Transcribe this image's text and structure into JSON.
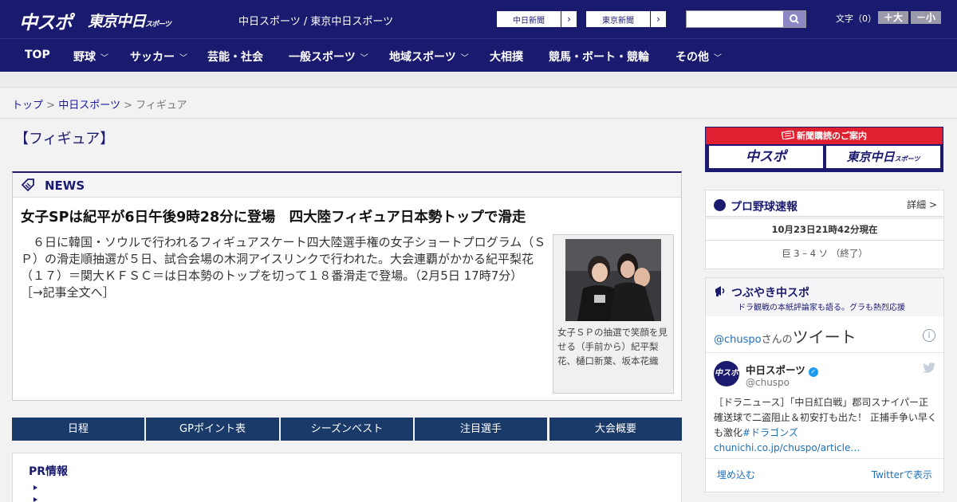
{
  "header": {
    "logo_main": "中スポ",
    "logo_tokyo": "東京中日",
    "logo_tokyo_small": "スポーツ",
    "site_name": "中日スポーツ / 東京中日スポーツ",
    "links": [
      "中日新聞",
      "東京新聞"
    ],
    "font_size_label": "文字（0）",
    "font_larger": "＋大",
    "font_smaller": "－小"
  },
  "nav": {
    "items": [
      {
        "label": "TOP"
      },
      {
        "label": "野球"
      },
      {
        "label": "サッカー"
      },
      {
        "label": "芸能・社会"
      },
      {
        "label": "一般スポーツ"
      },
      {
        "label": "地域スポーツ"
      },
      {
        "label": "大相撲"
      },
      {
        "label": "競馬・ボート・競輪"
      },
      {
        "label": "その他"
      }
    ],
    "chevron": "﹀"
  },
  "breadcrumb": {
    "items": [
      "トップ",
      "中日スポーツ",
      "フィギュア"
    ],
    "separator": ">"
  },
  "page_title": "【フィギュア】",
  "news": {
    "section_label": "NEWS",
    "headline": "女子SPは紀平が6日午後9時28分に登場　四大陸フィギュア日本勢トップで滑走",
    "body": "　６日に韓国・ソウルで行われるフィギュアスケート四大陸選手権の女子ショートプログラム（ＳＰ）の滑走順抽選が５日、試合会場の木洞アイスリンクで行われた。大会連覇がかかる紀平梨花（１７）＝関大ＫＦＳＣ＝は日本勢のトップを切って１８番滑走で登場。（2月5日 17時7分）",
    "more_link": "［→記事全文へ］",
    "photo_caption": "女子ＳＰの抽選で笑顔を見せる（手前から）紀平梨花、樋口新葉、坂本花織"
  },
  "tabs": [
    "日程",
    "GPポイント表",
    "シーズンベスト",
    "注目選手",
    "大会概要"
  ],
  "pr": {
    "title": "PR情報"
  },
  "subscription": {
    "title": "新聞購読のご案内",
    "logo_main": "中スポ",
    "logo_tokyo": "東京中日",
    "logo_tokyo_small": "スポーツ"
  },
  "baseball": {
    "title": "プロ野球速報",
    "detail_link": "詳細 >",
    "timestamp": "10月23日21時42分現在",
    "game": "巨 3 – 4 ソ （終了）"
  },
  "tweets": {
    "title": "つぶやき中スポ",
    "subtitle": "ドラ観戦の本紙評論家も語る。グラも熱烈応援",
    "handle_link": "@chuspo",
    "handle_suffix": "さんの",
    "tweets_label": "ツイート",
    "info_icon": "i",
    "account_name": "中日スポーツ",
    "account_handle": "@chuspo",
    "avatar_text": "中スポ",
    "tweet_text": "［ドラニュース］「中日紅白戦」郡司スナイパー正確送球で二盗阻止＆初安打も出た！ 正捕手争い早くも激化",
    "tweet_link": "#ドラゴンズchunichi.co.jp/chuspo/article…",
    "embed_link": "埋め込む",
    "view_link": "Twitterで表示"
  },
  "colors": {
    "brand_navy": "#1a1a6e",
    "tab_blue": "#1a3a6a",
    "subscribe_red": "#e02030",
    "twitter_blue": "#1d9bf0"
  }
}
